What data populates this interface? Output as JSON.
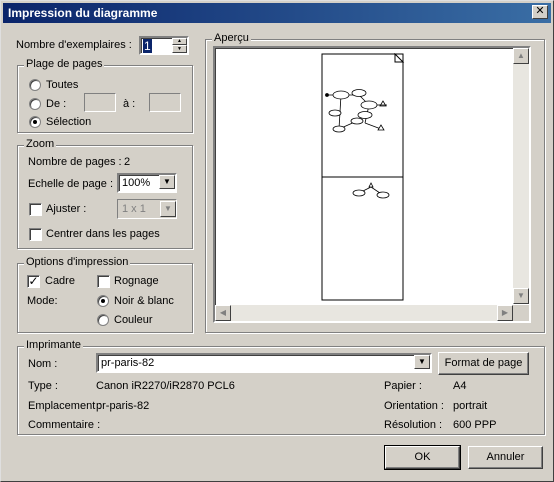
{
  "window": {
    "title": "Impression du diagramme",
    "close_glyph": "✕"
  },
  "copies": {
    "label": "Nombre d'exemplaires :",
    "value": "1"
  },
  "page_range": {
    "legend": "Plage de pages",
    "all_label": "Toutes",
    "from_label": "De :",
    "to_label": "à :",
    "selection_label": "Sélection",
    "selected": "selection"
  },
  "zoom": {
    "legend": "Zoom",
    "page_count_label": "Nombre de pages :",
    "page_count_value": "2",
    "scale_label": "Echelle de page :",
    "scale_value": "100%",
    "fit_label": "Ajuster :",
    "fit_value": "1 x 1",
    "fit_checked": false,
    "center_label": "Centrer dans les pages",
    "center_checked": false
  },
  "print_options": {
    "legend": "Options d'impression",
    "frame_label": "Cadre",
    "frame_checked": true,
    "crop_label": "Rognage",
    "crop_checked": false,
    "mode_label": "Mode:",
    "bw_label": "Noir & blanc",
    "color_label": "Couleur",
    "mode_selected": "bw"
  },
  "preview": {
    "legend": "Aperçu"
  },
  "printer": {
    "legend": "Imprimante",
    "name_label": "Nom :",
    "name_value": "pr-paris-82",
    "page_format_button": "Format de page",
    "type_label": "Type :",
    "type_value": "Canon iR2270/iR2870 PCL6",
    "location_label": "Emplacement :",
    "location_value": "pr-paris-82",
    "comment_label": "Commentaire :",
    "comment_value": "",
    "paper_label": "Papier :",
    "paper_value": "A4",
    "orientation_label": "Orientation :",
    "orientation_value": "portrait",
    "resolution_label": "Résolution :",
    "resolution_value": "600 PPP"
  },
  "buttons": {
    "ok": "OK",
    "cancel": "Annuler"
  }
}
